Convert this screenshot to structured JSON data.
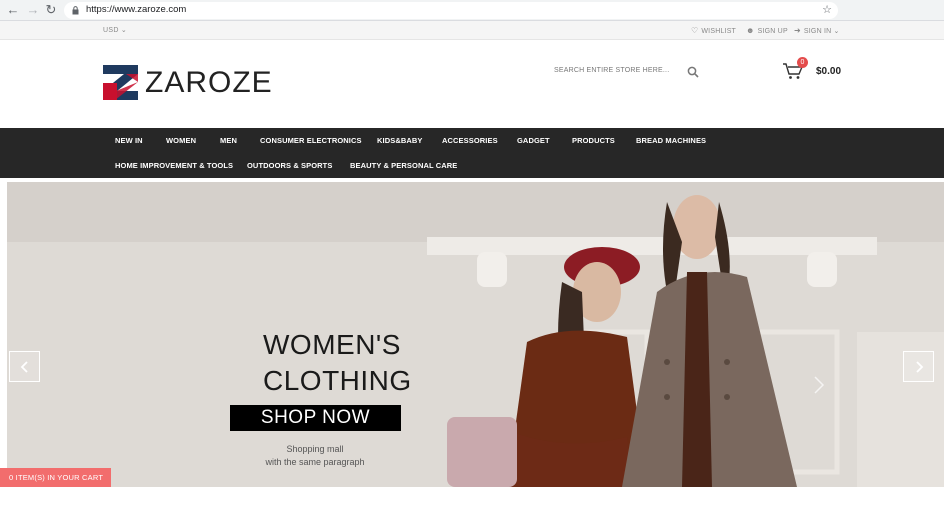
{
  "browser": {
    "url": "https://www.zaroze.com"
  },
  "util_bar": {
    "currency": "USD",
    "wishlist": "WISHLIST",
    "sign_up": "SIGN UP",
    "sign_in": "SIGN IN"
  },
  "header": {
    "logo_text": "ZAROZE",
    "search_placeholder": "SEARCH ENTIRE STORE HERE...",
    "cart_count": "0",
    "cart_total": "$0.00"
  },
  "nav": {
    "row1": [
      "NEW IN",
      "WOMEN",
      "MEN",
      "CONSUMER ELECTRONICS",
      "KIDS&BABY",
      "ACCESSORIES",
      "GADGET",
      "PRODUCTS",
      "BREAD MACHINES"
    ],
    "row2": [
      "HOME IMPROVEMENT & TOOLS",
      "OUTDOORS & SPORTS",
      "BEAUTY & PERSONAL CARE"
    ]
  },
  "hero": {
    "title_line1": "WOMEN'S",
    "title_line2": "CLOTHING",
    "button": "SHOP NOW",
    "sub_line1": "Shopping mall",
    "sub_line2": "with the same paragraph"
  },
  "cart_bar": {
    "label": "0 ITEM(S) IN YOUR CART"
  },
  "colors": {
    "nav_bg": "#272727",
    "accent": "#f26d6d",
    "logo_red": "#c8102e",
    "logo_navy": "#1f3a5f"
  }
}
